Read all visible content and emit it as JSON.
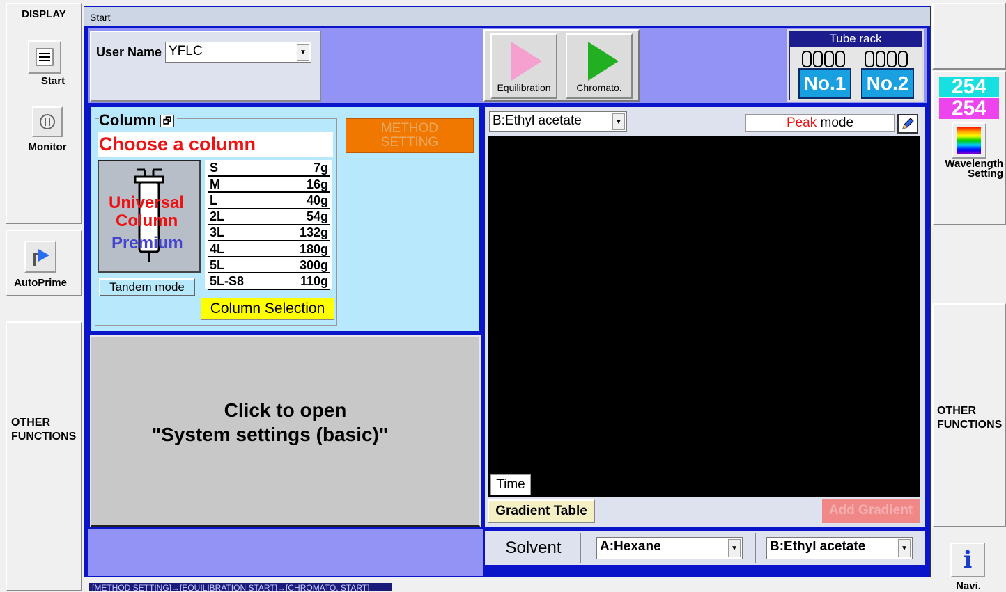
{
  "left_sidebar": {
    "display_label": "DISPLAY",
    "start_label": "Start",
    "monitor_label": "Monitor",
    "autoprime_label": "AutoPrime",
    "other_functions_label": "OTHER\nFUNCTIONS"
  },
  "right_sidebar": {
    "wavelength1": "254",
    "wavelength2": "254",
    "wavelength_label": "Wavelength\nSetting",
    "other_functions_label": "OTHER\nFUNCTIONS",
    "navi_label": "Navi."
  },
  "title": "Start",
  "user": {
    "label": "User Name",
    "value": "YFLC"
  },
  "actions": {
    "equilibration": "Equilibration",
    "chromato": "Chromato."
  },
  "tube_rack": {
    "title": "Tube rack",
    "no1": "No.1",
    "no2": "No.2"
  },
  "column": {
    "label": "Column",
    "choose": "Choose a column",
    "brand_line1": "Universal",
    "brand_line2": "Column",
    "brand_line3": "Premium",
    "tandem": "Tandem mode",
    "selection": "Column Selection",
    "sizes": [
      {
        "name": "S",
        "weight": "7g"
      },
      {
        "name": "M",
        "weight": "16g"
      },
      {
        "name": "L",
        "weight": "40g"
      },
      {
        "name": "2L",
        "weight": "54g"
      },
      {
        "name": "3L",
        "weight": "132g"
      },
      {
        "name": "4L",
        "weight": "180g"
      },
      {
        "name": "5L",
        "weight": "300g"
      },
      {
        "name": "5L-S8",
        "weight": "110g"
      }
    ]
  },
  "method_setting": "METHOD\nSETTING",
  "system_settings": {
    "line1": "Click to open",
    "line2": "\"System settings (basic)\""
  },
  "chart": {
    "solvent_select": "B:Ethyl acetate",
    "peak_word": "Peak",
    "mode_word": " mode",
    "time_label": "Time",
    "gradient_table": "Gradient Table",
    "add_gradient": "Add Gradient"
  },
  "solvent": {
    "label": "Solvent",
    "a": "A:Hexane",
    "b": "B:Ethyl acetate"
  },
  "status_bar": "[METHOD SETTING]→[EQUILIBRATION START]→[CHROMATO. START]",
  "colors": {
    "frame": "#0a14c8",
    "periwinkle": "#9393f5",
    "orange": "#f07800",
    "yellow": "#ffff00",
    "red": "#ee1111",
    "cyan": "#18b4e0"
  }
}
